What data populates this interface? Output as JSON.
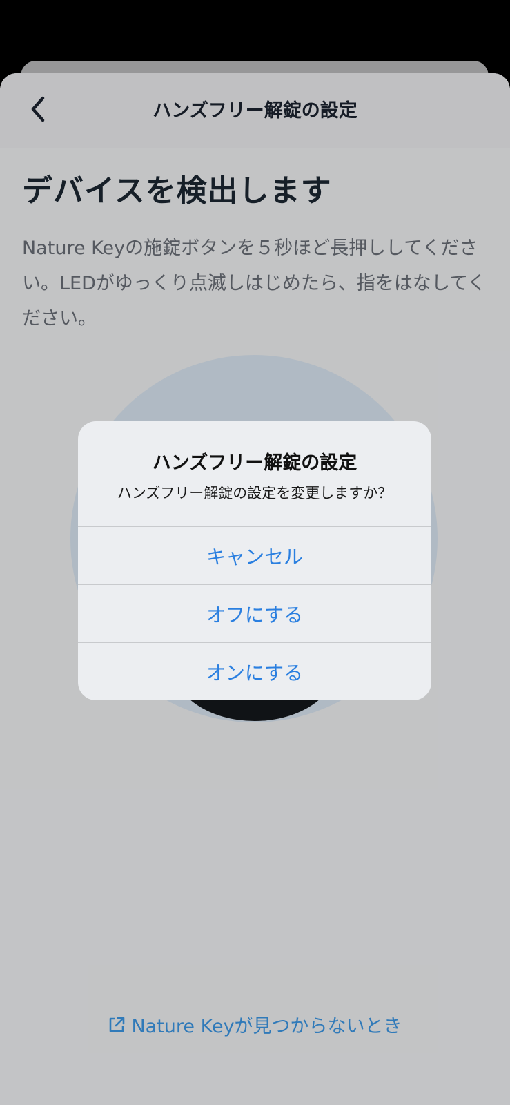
{
  "nav": {
    "title": "ハンズフリー解錠の設定",
    "back_icon": "chevron-left-icon"
  },
  "main": {
    "heading": "デバイスを検出します",
    "description": "Nature Keyの施錠ボタンを５秒ほど長押ししてください。LEDがゆっくり点滅しはじめたら、指をはなしてください。",
    "help_link": "Nature Keyが見つからないとき",
    "help_icon": "external-link-icon"
  },
  "alert": {
    "title": "ハンズフリー解錠の設定",
    "message": "ハンズフリー解錠の設定を変更しますか？",
    "buttons": [
      "キャンセル",
      "オフにする",
      "オンにする"
    ]
  },
  "colors": {
    "accent": "#2a7fe0",
    "link": "#3d99e8",
    "heading": "#1c2733",
    "description": "#6b7079",
    "device_circle": "#dde9f5"
  }
}
